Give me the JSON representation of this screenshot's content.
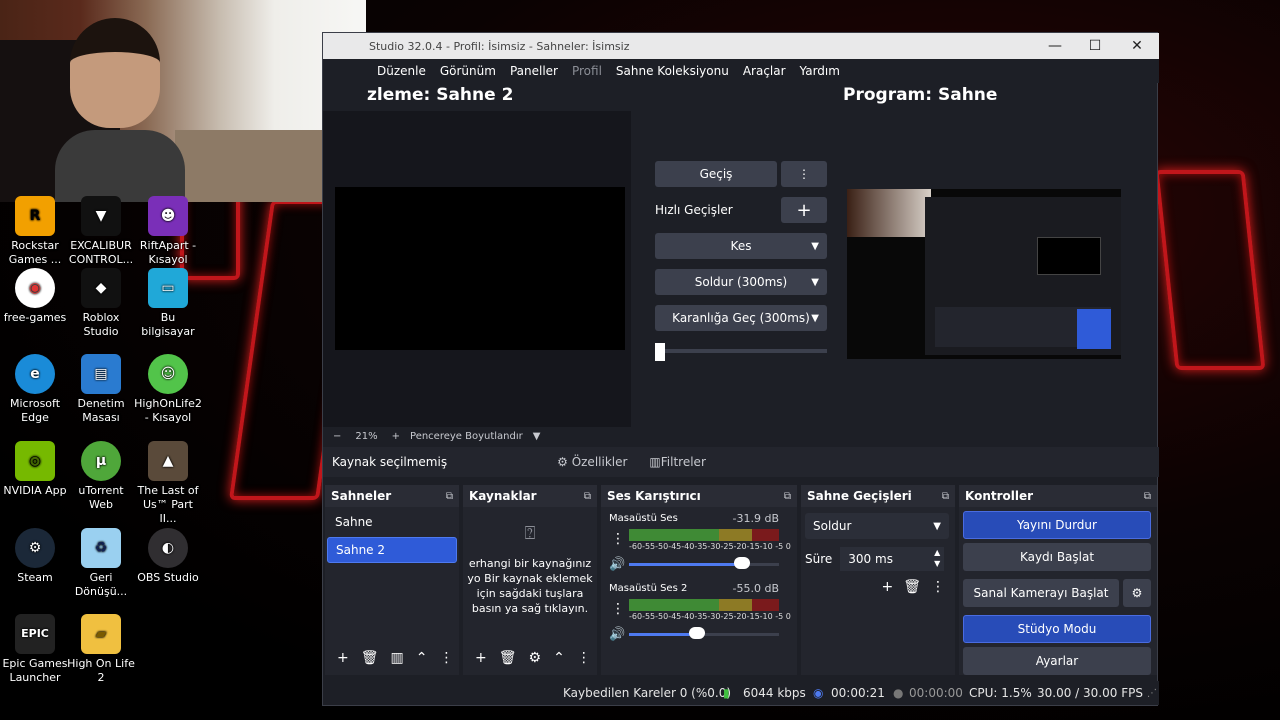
{
  "obs": {
    "title": "Studio 32.0.4 - Profil: İsimsiz - Sahneler: İsimsiz",
    "menu": [
      "Düzenle",
      "Görünüm",
      "Paneller",
      "Profil",
      "Sahne Koleksiyonu",
      "Araçlar",
      "Yardım"
    ],
    "preview_label": "zleme: Sahne 2",
    "program_label": "Program: Sahne",
    "transitions": {
      "transition_btn": "Geçiş",
      "quick_label": "Hızlı Geçişler",
      "items": [
        "Kes",
        "Soldur (300ms)",
        "Karanlığa Geç (300ms)"
      ]
    },
    "zoom": {
      "minus": "−",
      "value": "21%",
      "plus": "+",
      "fit": "Pencereye Boyutlandır"
    },
    "source_bar": {
      "none": "Kaynak seçilmemiş",
      "props": "Özellikler",
      "filters": "Filtreler"
    },
    "scenes": {
      "title": "Sahneler",
      "items": [
        "Sahne",
        "Sahne 2"
      ],
      "selected_index": 1
    },
    "sources": {
      "title": "Kaynaklar",
      "empty_text": "erhangi bir kaynağınız yo Bir kaynak eklemek için sağdaki tuşlara basın ya sağ tıklayın."
    },
    "mixer": {
      "title": "Ses Karıştırıcı",
      "channels": [
        {
          "name": "Masaüstü Ses",
          "db": "-31.9 dB",
          "volume": 0.75
        },
        {
          "name": "Masaüstü Ses 2",
          "db": "-55.0 dB",
          "volume": 0.45
        }
      ],
      "scale": "-60-55-50-45-40-35-30-25-20-15-10 -5 0"
    },
    "scene_transitions": {
      "title": "Sahne Geçişleri",
      "selected": "Soldur",
      "duration_label": "Süre",
      "duration_value": "300 ms"
    },
    "controls": {
      "title": "Kontroller",
      "stop_stream": "Yayını Durdur",
      "start_record": "Kaydı Başlat",
      "virtual_cam": "Sanal Kamerayı Başlat",
      "studio_mode": "Stüdyo Modu",
      "settings": "Ayarlar"
    },
    "status": {
      "dropped": "Kaybedilen Kareler 0 (%0.0)",
      "bitrate": "6044 kbps",
      "stream_time": "00:00:21",
      "rec_time": "00:00:00",
      "cpu": "CPU: 1.5%",
      "fps": "30.00 / 30.00 FPS"
    }
  },
  "desktop": {
    "icons": [
      {
        "label": "Rockstar Games ...",
        "color": "#f2a000"
      },
      {
        "label": "EXCALIBUR CONTROL...",
        "color": "#222"
      },
      {
        "label": "RiftApart - Kısayol",
        "color": "#7a2fb8"
      },
      {
        "label": "free-games",
        "color": "#ffffff"
      },
      {
        "label": "Roblox Studio",
        "color": "#222"
      },
      {
        "label": "Bu bilgisayar",
        "color": "#20a8d8"
      },
      {
        "label": "Microsoft Edge",
        "color": "#1a8bd8"
      },
      {
        "label": "Denetim Masası",
        "color": "#2a7bd0"
      },
      {
        "label": "HighOnLife2 - Kısayol",
        "color": "#52c44a"
      },
      {
        "label": "NVIDIA App",
        "color": "#76b900"
      },
      {
        "label": "uTorrent Web",
        "color": "#4fa73a"
      },
      {
        "label": "The Last of Us™ Part II...",
        "color": "#5a4a3a"
      },
      {
        "label": "Steam",
        "color": "#1b2838"
      },
      {
        "label": "Geri Dönüşü...",
        "color": "#9ad0f0"
      },
      {
        "label": "OBS Studio",
        "color": "#302e31"
      },
      {
        "label": "Epic Games Launcher",
        "color": "#222"
      },
      {
        "label": "High On Life 2",
        "color": "#f0c040"
      }
    ]
  }
}
